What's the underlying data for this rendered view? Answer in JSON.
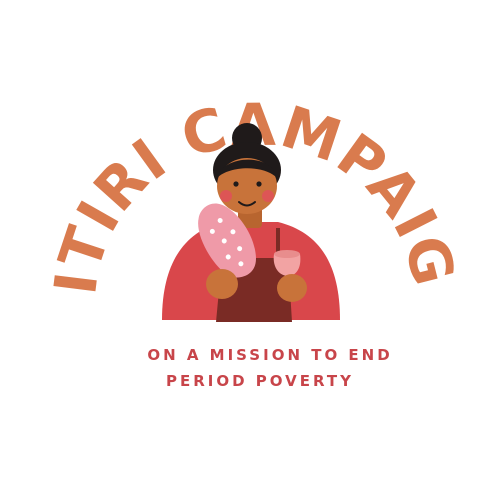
{
  "logo": {
    "title": "SITIRI CAMPAIGN",
    "tagline_line_1": "ON A MISSION TO END",
    "tagline_line_2": "PERIOD POVERTY",
    "colors": {
      "title": "#d97b4e",
      "tagline": "#c8454a",
      "shirt": "#d9474b",
      "apron": "#7a2b25",
      "skin": "#c8733a",
      "hair": "#1f1a1a",
      "pad": "#ef9aa8",
      "cup": "#f2a3a3",
      "background": "#ffffff"
    },
    "illustration": "woman-holding-reusable-pad-and-menstrual-cup"
  }
}
